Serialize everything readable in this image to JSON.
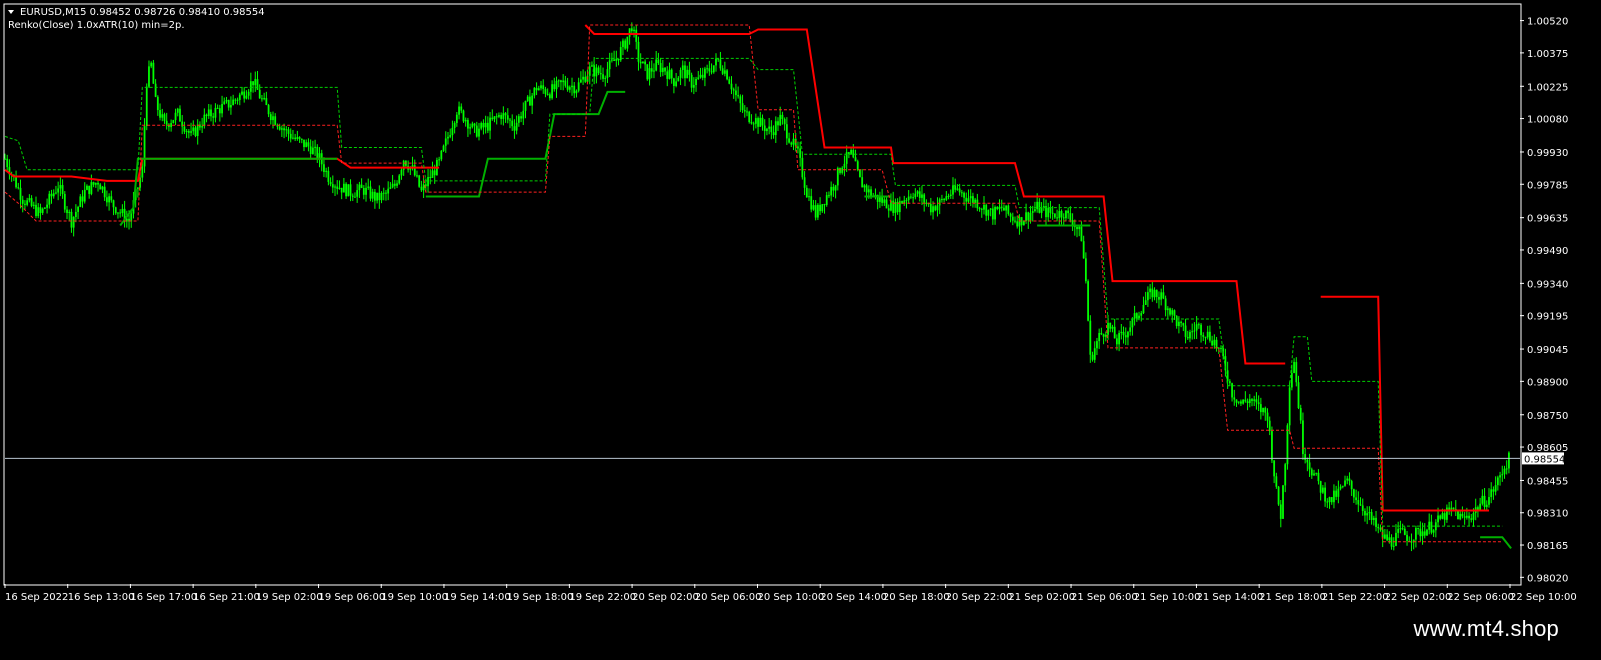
{
  "header": {
    "symbol_line": "EURUSD,M15  0.98452 0.98726 0.98410 0.98554",
    "indicator_line": "Renko(Close) 1.0xATR(10) min=2p."
  },
  "watermark": "www.mt4.shop",
  "colors": {
    "background": "#000000",
    "candles": "#00ff00",
    "renko_up": "#00b000",
    "renko_down": "#ff0000",
    "price_line": "#b8c4d0",
    "axis": "#ffffff"
  },
  "chart_data": {
    "type": "line",
    "symbol": "EURUSD",
    "timeframe": "M15",
    "current_price_label": "0.98554",
    "ylim": [
      0.9799,
      1.0059
    ],
    "y_ticks": [
      1.0052,
      1.00375,
      1.00225,
      1.0008,
      0.9993,
      0.99785,
      0.99635,
      0.9949,
      0.9934,
      0.99195,
      0.99045,
      0.989,
      0.9875,
      0.98605,
      0.98455,
      0.9831,
      0.98165,
      0.9802
    ],
    "y_tick_labels": [
      "1.00520",
      "1.00375",
      "1.00225",
      "1.00080",
      "0.99930",
      "0.99785",
      "0.99635",
      "0.99490",
      "0.99340",
      "0.99195",
      "0.99045",
      "0.98900",
      "0.98750",
      "0.98605",
      "0.98455",
      "0.98310",
      "0.98165",
      "0.98020"
    ],
    "x_tick_labels": [
      "16 Sep 2022",
      "16 Sep 13:00",
      "16 Sep 17:00",
      "16 Sep 21:00",
      "19 Sep 02:00",
      "19 Sep 06:00",
      "19 Sep 10:00",
      "19 Sep 14:00",
      "19 Sep 18:00",
      "19 Sep 22:00",
      "20 Sep 02:00",
      "20 Sep 06:00",
      "20 Sep 10:00",
      "20 Sep 14:00",
      "20 Sep 18:00",
      "20 Sep 22:00",
      "21 Sep 02:00",
      "21 Sep 06:00",
      "21 Sep 10:00",
      "21 Sep 14:00",
      "21 Sep 18:00",
      "21 Sep 22:00",
      "22 Sep 02:00",
      "22 Sep 06:00",
      "22 Sep 10:00"
    ],
    "price_path_close": [
      [
        0,
        0.999
      ],
      [
        8,
        0.9972
      ],
      [
        16,
        0.9965
      ],
      [
        24,
        0.9978
      ],
      [
        30,
        0.9962
      ],
      [
        36,
        0.9975
      ],
      [
        42,
        0.998
      ],
      [
        48,
        0.997
      ],
      [
        56,
        0.9962
      ],
      [
        62,
        0.9985
      ],
      [
        64,
        1.0025
      ],
      [
        66,
        1.0032
      ],
      [
        68,
        1.0015
      ],
      [
        72,
        1.0005
      ],
      [
        78,
        1.001
      ],
      [
        84,
        1.0
      ],
      [
        90,
        1.0008
      ],
      [
        96,
        1.0012
      ],
      [
        102,
        1.0015
      ],
      [
        108,
        1.002
      ],
      [
        112,
        1.0025
      ],
      [
        116,
        1.0016
      ],
      [
        120,
        1.001
      ],
      [
        126,
        1.0003
      ],
      [
        132,
        0.9998
      ],
      [
        138,
        0.9995
      ],
      [
        142,
        0.999
      ],
      [
        146,
        0.9982
      ],
      [
        150,
        0.9978
      ],
      [
        156,
        0.9975
      ],
      [
        162,
        0.9976
      ],
      [
        168,
        0.9972
      ],
      [
        172,
        0.9974
      ],
      [
        176,
        0.9978
      ],
      [
        180,
        0.999
      ],
      [
        184,
        0.9985
      ],
      [
        188,
        0.9975
      ],
      [
        192,
        0.9982
      ],
      [
        196,
        0.9988
      ],
      [
        200,
        1.0
      ],
      [
        204,
        1.0012
      ],
      [
        208,
        1.0008
      ],
      [
        212,
        1.0002
      ],
      [
        218,
        1.0005
      ],
      [
        224,
        1.001
      ],
      [
        230,
        1.0005
      ],
      [
        236,
        1.0015
      ],
      [
        240,
        1.0022
      ],
      [
        246,
        1.002
      ],
      [
        252,
        1.0024
      ],
      [
        258,
        1.0022
      ],
      [
        264,
        1.003
      ],
      [
        270,
        1.0028
      ],
      [
        276,
        1.0035
      ],
      [
        280,
        1.0042
      ],
      [
        283,
        1.005
      ],
      [
        286,
        1.0035
      ],
      [
        290,
        1.0028
      ],
      [
        294,
        1.0032
      ],
      [
        298,
        1.003
      ],
      [
        302,
        1.0025
      ],
      [
        306,
        1.003
      ],
      [
        310,
        1.0024
      ],
      [
        314,
        1.0026
      ],
      [
        318,
        1.003
      ],
      [
        322,
        1.0034
      ],
      [
        326,
        1.0028
      ],
      [
        330,
        1.0018
      ],
      [
        334,
        1.001
      ],
      [
        338,
        1.0008
      ],
      [
        342,
        1.0005
      ],
      [
        346,
        1.0002
      ],
      [
        350,
        1.0008
      ],
      [
        354,
        1.0
      ],
      [
        358,
        0.9992
      ],
      [
        362,
        0.9975
      ],
      [
        366,
        0.9965
      ],
      [
        370,
        0.9972
      ],
      [
        374,
        0.9978
      ],
      [
        378,
        0.9988
      ],
      [
        382,
        0.9992
      ],
      [
        386,
        0.998
      ],
      [
        390,
        0.9975
      ],
      [
        394,
        0.9972
      ],
      [
        398,
        0.997
      ],
      [
        402,
        0.9968
      ],
      [
        406,
        0.9972
      ],
      [
        410,
        0.9975
      ],
      [
        414,
        0.9972
      ],
      [
        418,
        0.9968
      ],
      [
        422,
        0.997
      ],
      [
        426,
        0.9974
      ],
      [
        430,
        0.9976
      ],
      [
        434,
        0.9973
      ],
      [
        438,
        0.9971
      ],
      [
        442,
        0.9968
      ],
      [
        446,
        0.9965
      ],
      [
        450,
        0.9968
      ],
      [
        454,
        0.9964
      ],
      [
        458,
        0.9962
      ],
      [
        462,
        0.9965
      ],
      [
        466,
        0.9968
      ],
      [
        470,
        0.9966
      ],
      [
        474,
        0.9965
      ],
      [
        478,
        0.9966
      ],
      [
        482,
        0.9962
      ],
      [
        486,
        0.9955
      ],
      [
        488,
        0.9935
      ],
      [
        490,
        0.99
      ],
      [
        494,
        0.991
      ],
      [
        498,
        0.9915
      ],
      [
        502,
        0.9908
      ],
      [
        506,
        0.9912
      ],
      [
        510,
        0.9918
      ],
      [
        514,
        0.9925
      ],
      [
        518,
        0.993
      ],
      [
        522,
        0.9928
      ],
      [
        526,
        0.9922
      ],
      [
        530,
        0.9915
      ],
      [
        534,
        0.991
      ],
      [
        538,
        0.9915
      ],
      [
        542,
        0.9912
      ],
      [
        546,
        0.9908
      ],
      [
        550,
        0.99
      ],
      [
        554,
        0.9885
      ],
      [
        558,
        0.988
      ],
      [
        562,
        0.9882
      ],
      [
        566,
        0.9878
      ],
      [
        570,
        0.9875
      ],
      [
        574,
        0.984
      ],
      [
        576,
        0.983
      ],
      [
        578,
        0.9855
      ],
      [
        580,
        0.989
      ],
      [
        582,
        0.99
      ],
      [
        584,
        0.988
      ],
      [
        586,
        0.986
      ],
      [
        590,
        0.985
      ],
      [
        594,
        0.9842
      ],
      [
        598,
        0.9836
      ],
      [
        602,
        0.984
      ],
      [
        606,
        0.9845
      ],
      [
        610,
        0.9838
      ],
      [
        614,
        0.9832
      ],
      [
        618,
        0.9826
      ],
      [
        622,
        0.982
      ],
      [
        626,
        0.9818
      ],
      [
        630,
        0.9822
      ],
      [
        634,
        0.982
      ],
      [
        638,
        0.9822
      ],
      [
        642,
        0.9824
      ],
      [
        646,
        0.9826
      ],
      [
        650,
        0.983
      ],
      [
        654,
        0.9832
      ],
      [
        658,
        0.9828
      ],
      [
        662,
        0.983
      ],
      [
        666,
        0.9835
      ],
      [
        670,
        0.9838
      ],
      [
        674,
        0.9845
      ],
      [
        677,
        0.9852
      ],
      [
        679,
        0.9855
      ]
    ],
    "series": [
      {
        "kind": "renko_upper",
        "color": "#ff0000",
        "values": [
          [
            0,
            0.9985
          ],
          [
            4,
            0.9982
          ],
          [
            30,
            0.9982
          ],
          [
            46,
            0.998
          ],
          [
            60,
            0.998
          ],
          [
            62,
            0.999
          ],
          [
            150,
            0.999
          ],
          [
            156,
            0.9986
          ],
          [
            190,
            0.9986
          ],
          [
            196,
            0.9986
          ],
          [
            210,
            null
          ],
          [
            262,
            1.005
          ],
          [
            266,
            1.0046
          ],
          [
            336,
            1.0046
          ],
          [
            340,
            1.0048
          ],
          [
            362,
            1.0048
          ],
          [
            370,
            0.9995
          ],
          [
            400,
            0.9995
          ],
          [
            401,
            0.9988
          ],
          [
            456,
            0.9988
          ],
          [
            460,
            0.9973
          ],
          [
            496,
            0.9973
          ],
          [
            500,
            0.9935
          ],
          [
            556,
            0.9935
          ],
          [
            560,
            0.9898
          ],
          [
            578,
            0.9898
          ],
          [
            590,
            null
          ],
          [
            594,
            0.9928
          ],
          [
            620,
            0.9928
          ],
          [
            622,
            0.9832
          ],
          [
            670,
            0.9832
          ]
        ]
      },
      {
        "kind": "renko_lower",
        "color": "#00b000",
        "values": [
          [
            52,
            0.996
          ],
          [
            58,
            0.9968
          ],
          [
            60,
            0.999
          ],
          [
            150,
            0.999
          ],
          [
            152,
            null
          ],
          [
            190,
            0.9973
          ],
          [
            214,
            0.9973
          ],
          [
            218,
            0.999
          ],
          [
            244,
            0.999
          ],
          [
            248,
            1.001
          ],
          [
            268,
            1.001
          ],
          [
            272,
            1.002
          ],
          [
            280,
            1.002
          ],
          [
            282,
            null
          ],
          [
            388,
            0.9973
          ],
          [
            400,
            0.9973
          ],
          [
            402,
            null
          ],
          [
            466,
            0.996
          ],
          [
            490,
            0.996
          ],
          [
            492,
            null
          ],
          [
            666,
            0.982
          ],
          [
            676,
            0.982
          ],
          [
            680,
            0.9815
          ]
        ]
      },
      {
        "kind": "renko_mid_up_dashed",
        "color": "#00d000",
        "values": [
          [
            0,
            1.0
          ],
          [
            6,
            0.9998
          ],
          [
            10,
            0.9985
          ],
          [
            60,
            0.9985
          ],
          [
            62,
            1.0022
          ],
          [
            150,
            1.0022
          ],
          [
            152,
            0.9995
          ],
          [
            188,
            0.9995
          ],
          [
            190,
            0.998
          ],
          [
            244,
            0.998
          ],
          [
            246,
            1.001
          ],
          [
            264,
            1.001
          ],
          [
            266,
            1.0035
          ],
          [
            336,
            1.0035
          ],
          [
            340,
            1.003
          ],
          [
            356,
            1.003
          ],
          [
            360,
            0.9992
          ],
          [
            400,
            0.9992
          ],
          [
            402,
            0.9978
          ],
          [
            456,
            0.9978
          ],
          [
            458,
            0.9968
          ],
          [
            494,
            0.9968
          ],
          [
            498,
            0.9918
          ],
          [
            548,
            0.9918
          ],
          [
            552,
            0.9888
          ],
          [
            580,
            0.9888
          ],
          [
            582,
            0.991
          ],
          [
            588,
            0.991
          ],
          [
            590,
            0.989
          ],
          [
            620,
            0.989
          ],
          [
            622,
            0.9825
          ],
          [
            676,
            0.9825
          ]
        ]
      },
      {
        "kind": "renko_mid_down_dashed",
        "color": "#ff2020",
        "values": [
          [
            0,
            0.9975
          ],
          [
            6,
            0.997
          ],
          [
            14,
            0.9962
          ],
          [
            60,
            0.9962
          ],
          [
            62,
            1.0005
          ],
          [
            150,
            1.0005
          ],
          [
            152,
            0.9988
          ],
          [
            188,
            0.9988
          ],
          [
            190,
            0.9975
          ],
          [
            244,
            0.9975
          ],
          [
            246,
            1.0
          ],
          [
            262,
            1.0
          ],
          [
            264,
            1.005
          ],
          [
            336,
            1.005
          ],
          [
            340,
            1.0012
          ],
          [
            356,
            1.0012
          ],
          [
            358,
            0.9985
          ],
          [
            396,
            0.9985
          ],
          [
            400,
            0.997
          ],
          [
            456,
            0.997
          ],
          [
            458,
            0.9962
          ],
          [
            494,
            0.9962
          ],
          [
            498,
            0.9905
          ],
          [
            548,
            0.9905
          ],
          [
            552,
            0.9868
          ],
          [
            580,
            0.9868
          ],
          [
            582,
            0.986
          ],
          [
            620,
            0.986
          ],
          [
            622,
            0.9818
          ],
          [
            676,
            0.9818
          ]
        ]
      }
    ],
    "grid": false,
    "legend": "none"
  }
}
